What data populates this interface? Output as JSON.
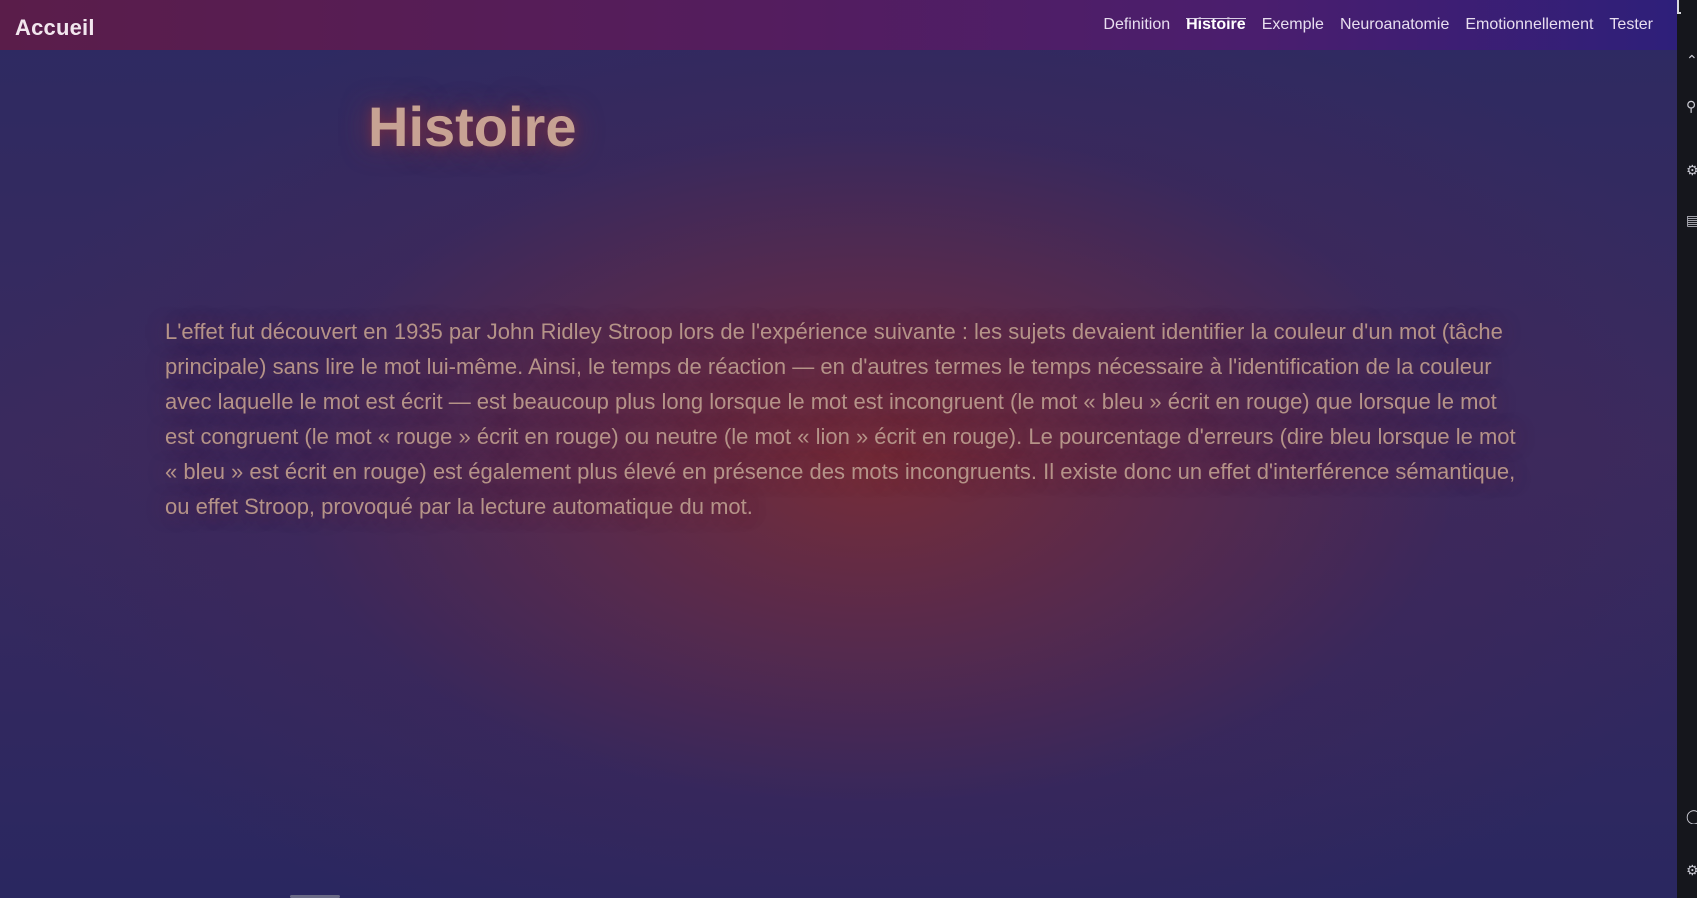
{
  "brand": {
    "label": "Accueil"
  },
  "nav": {
    "items": [
      {
        "label": "Definition",
        "active": false
      },
      {
        "label": "Histoire",
        "active": true
      },
      {
        "label": "Exemple",
        "active": false
      },
      {
        "label": "Neuroanatomie",
        "active": false
      },
      {
        "label": "Emotionnellement",
        "active": false
      },
      {
        "label": "Tester",
        "active": false
      }
    ]
  },
  "main": {
    "title": "Histoire",
    "paragraph": "L'effet fut découvert en 1935 par John Ridley Stroop lors de l'expérience suivante : les sujets devaient identifier la couleur d'un mot (tâche principale) sans lire le mot lui-même. Ainsi, le temps de réaction — en d'autres termes le temps nécessaire à l'identification de la couleur avec laquelle le mot est écrit — est beaucoup plus long lorsque le mot est incongruent (le mot « bleu » écrit en rouge) que lorsque le mot est congruent (le mot « rouge » écrit en rouge) ou neutre (le mot « lion » écrit en rouge). Le pourcentage d'erreurs (dire bleu lorsque le mot « bleu » est écrit en rouge) est également plus élevé en présence des mots incongruents. Il existe donc un effet d'interférence sémantique, ou effet Stroop, provoqué par la lecture automatique du mot."
  },
  "colors": {
    "topbar_start": "#5a1d4a",
    "topbar_end": "#2e1f7a",
    "title_color": "#c7a293",
    "text_color": "#b59388",
    "background_center": "#782d37",
    "background_edge": "#2a2760"
  },
  "side_panel": {
    "icons": [
      "collapse-icon",
      "share-icon",
      "settings-icon",
      "layout-icon",
      "help-icon",
      "extensions-icon"
    ]
  }
}
